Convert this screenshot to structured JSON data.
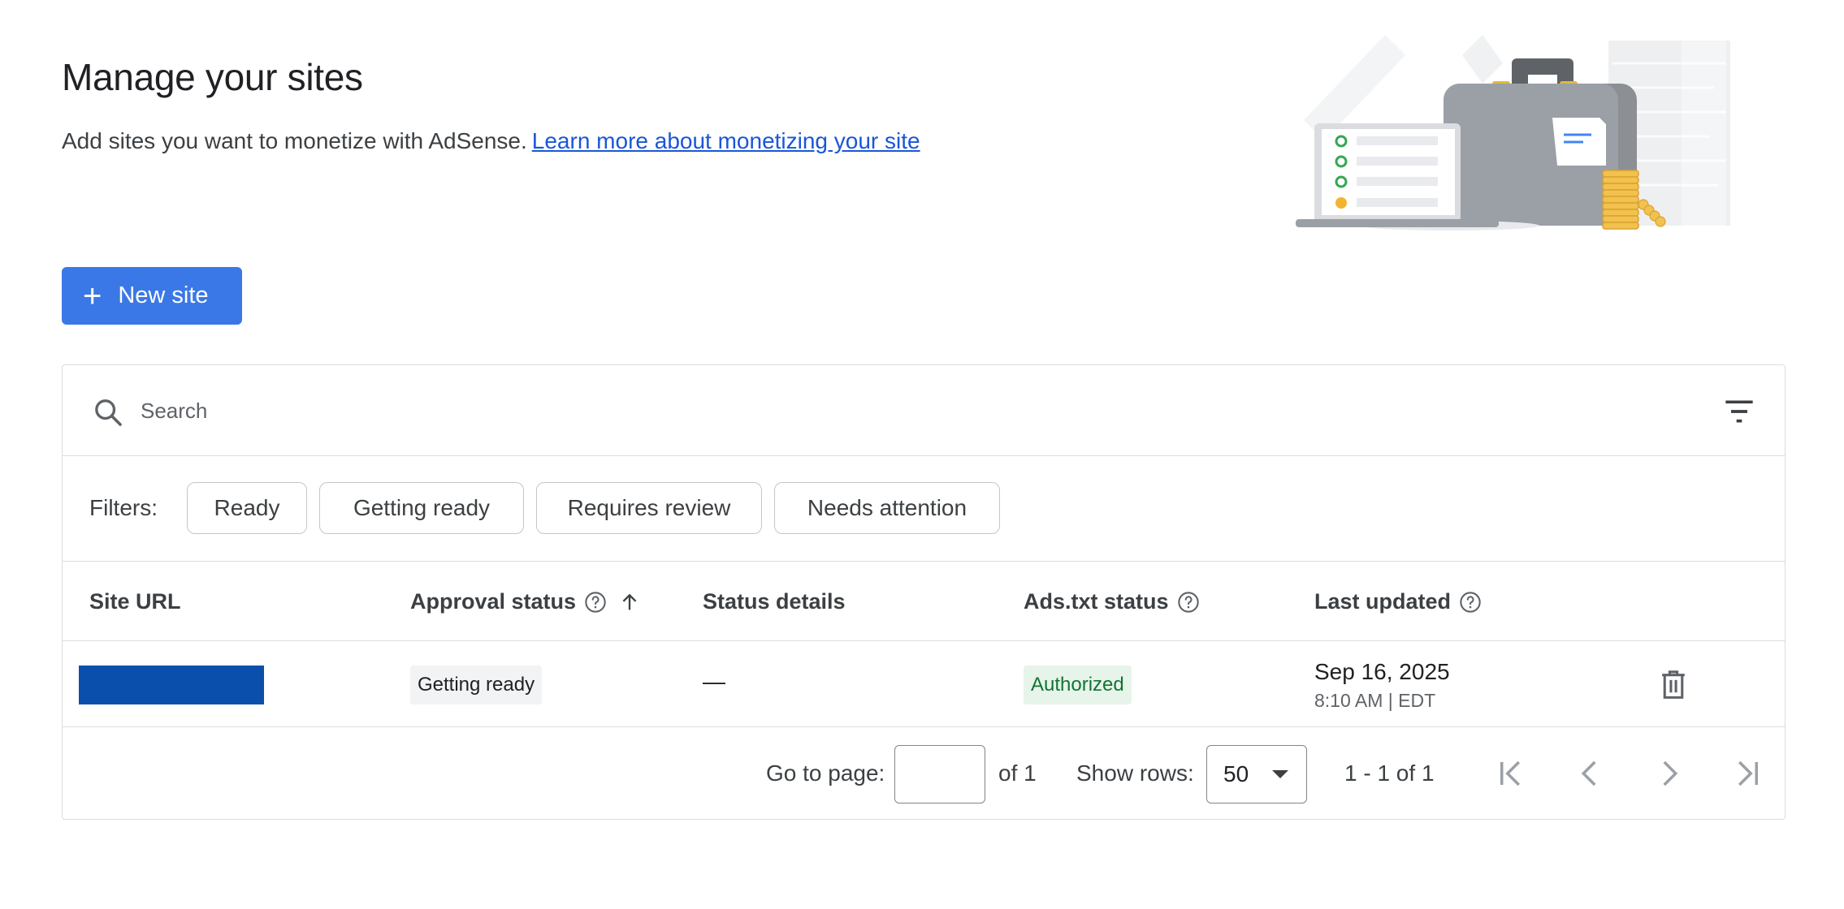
{
  "header": {
    "title": "Manage your sites",
    "subtitle": "Add sites you want to monetize with AdSense.",
    "learn_more_link": "Learn more about monetizing your site"
  },
  "toolbar": {
    "new_site_label": "New site",
    "new_site_icon": "plus-icon"
  },
  "search": {
    "placeholder": "Search",
    "icon": "search-icon",
    "filter_icon": "filter-list-icon"
  },
  "filters": {
    "label": "Filters:",
    "chips": [
      "Ready",
      "Getting ready",
      "Requires review",
      "Needs attention"
    ]
  },
  "table": {
    "columns": [
      {
        "label": "Site URL",
        "help": false,
        "sort": null
      },
      {
        "label": "Approval status",
        "help": true,
        "sort": "ascending"
      },
      {
        "label": "Status details",
        "help": false,
        "sort": null
      },
      {
        "label": "Ads.txt status",
        "help": true,
        "sort": null
      },
      {
        "label": "Last updated",
        "help": true,
        "sort": null
      }
    ],
    "rows": [
      {
        "site_url": "",
        "approval_status": "Getting ready",
        "status_details": "—",
        "ads_txt_status": "Authorized",
        "last_updated_date": "Sep 16, 2025",
        "last_updated_time": "8:10 AM | EDT"
      }
    ]
  },
  "pagination": {
    "go_to_page_label": "Go to page:",
    "page_value": "",
    "of_pages": "of 1",
    "show_rows_label": "Show rows:",
    "rows_per_page": "50",
    "range_text": "1 - 1 of 1"
  },
  "colors": {
    "primary_button": "#3b78e7",
    "link": "#1a56d6",
    "redacted_url": "#0b4fad",
    "authorized_bg": "#e6f4ea",
    "authorized_text": "#137333",
    "getting_ready_bg": "#f1f3f4"
  }
}
